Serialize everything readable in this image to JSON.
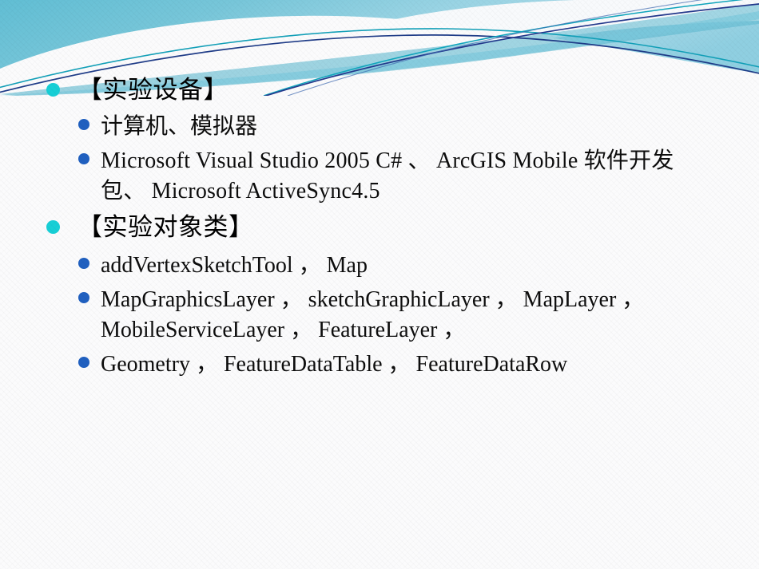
{
  "slide": {
    "background_color": "#fbfbfc",
    "header": {
      "gradient_from": "#6cc0d6",
      "gradient_to": "#a9d8e6",
      "line_navy": "#1f3c88",
      "line_teal": "#169cb5",
      "wave_white": "#ffffff"
    },
    "bullet_colors": {
      "level1": "#17cfd6",
      "level2": "#2060c0"
    },
    "items": [
      {
        "level": 1,
        "text": "【实验设备】",
        "name": "heading-experiment-equipment"
      },
      {
        "level": 2,
        "text": "计算机、模拟器",
        "name": "item-computer-simulator"
      },
      {
        "level": 2,
        "text": "Microsoft Visual Studio 2005 C# 、 ArcGIS Mobile 软件开发包、 Microsoft ActiveSync4.5",
        "name": "item-software-packages"
      },
      {
        "level": 1,
        "text": "【实验对象类】",
        "name": "heading-experiment-object-classes"
      },
      {
        "level": 2,
        "text": "addVertexSketchTool ， Map",
        "name": "item-classes-sketchtool-map"
      },
      {
        "level": 2,
        "text": "MapGraphicsLayer ， sketchGraphicLayer ， MapLayer ， MobileServiceLayer ， FeatureLayer ，",
        "name": "item-classes-layers"
      },
      {
        "level": 2,
        "text": "Geometry ， FeatureDataTable ， FeatureDataRow",
        "name": "item-classes-geometry-tables"
      }
    ]
  }
}
